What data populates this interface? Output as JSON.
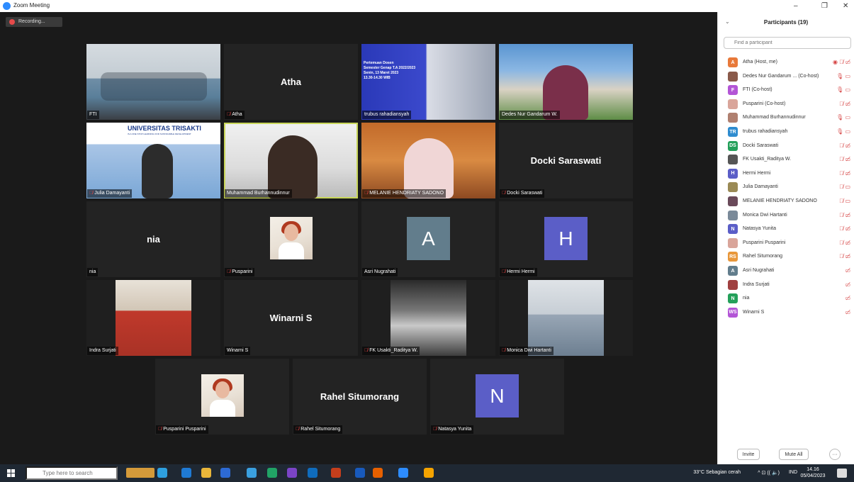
{
  "window": {
    "title": "Zoom Meeting",
    "minimize": "–",
    "restore": "❐",
    "close": "✕"
  },
  "recording": {
    "label": "Recording..."
  },
  "tiles": [
    {
      "label": "FTI",
      "muted": false
    },
    {
      "label": "Atha",
      "muted": true,
      "display_name": "Atha"
    },
    {
      "label": "trubus rahadiansyah",
      "muted": false,
      "slide_lines": [
        "Pertemuan Dosen",
        "Semester Genap T.A 2022/2023",
        "",
        "Senin, 13 Maret 2023",
        "13.30-14.30 WIB"
      ]
    },
    {
      "label": "Dedes Nur Gandarum W.",
      "muted": false
    },
    {
      "label": "Julia Damayanti",
      "muted": true,
      "banner": "UNIVERSITAS TRISAKTI",
      "banner_sub": "IS A ONE STOP LEARNING FOR SUSTAINABLE DEVELOPMENT"
    },
    {
      "label": "Muhammad Burhannudinnur",
      "muted": false
    },
    {
      "label": "MELANIE HENDRIATY SADONO",
      "muted": true
    },
    {
      "label": "Docki Saraswati",
      "muted": true,
      "display_name": "Docki Saraswati"
    },
    {
      "label": "nia",
      "muted": false,
      "display_name": "nia"
    },
    {
      "label": "Pusparini",
      "muted": true
    },
    {
      "label": "Asri Nugrahati",
      "muted": false,
      "initial": "A",
      "color": "#627d8c"
    },
    {
      "label": "Hermi Hermi",
      "muted": true,
      "initial": "H",
      "color": "#5b5ec7"
    },
    {
      "label": "Indra Surjati",
      "muted": false
    },
    {
      "label": "Winarni S",
      "muted": false,
      "display_name": "Winarni S"
    },
    {
      "label": "FK Usakti_Raditya W.",
      "muted": true
    },
    {
      "label": "Monica Dwi Hartanti",
      "muted": true
    },
    {
      "label": "Pusparini Pusparini",
      "muted": true
    },
    {
      "label": "Rahel Situmorang",
      "muted": true,
      "display_name": "Rahel Situmorang"
    },
    {
      "label": "Natasya Yunita",
      "muted": true,
      "initial": "N",
      "color": "#5b5ec7"
    }
  ],
  "sidebar": {
    "title": "Participants (19)",
    "search_placeholder": "Find a participant",
    "participants": [
      {
        "name": "Atha (Host, me)",
        "initial": "A",
        "color": "#e8793a",
        "icons": "◉ 🎙̸ ▭̸"
      },
      {
        "name": "Dedes Nur Gandarum ... (Co-host)",
        "initial": "",
        "color": "#8a5a4a",
        "icons": "🎙 ▭"
      },
      {
        "name": "FTI (Co-host)",
        "initial": "F",
        "color": "#b355d6",
        "icons": "🎙 ▭"
      },
      {
        "name": "Pusparini (Co-host)",
        "initial": "",
        "color": "#d9a59a",
        "icons": "🎙̸ ▭̸"
      },
      {
        "name": "Muhammad Burhannudinnur",
        "initial": "",
        "color": "#b08070",
        "icons": "🎙 ▭"
      },
      {
        "name": "trubus rahadiansyah",
        "initial": "TR",
        "color": "#2f8ccf",
        "icons": "🎙 ▭"
      },
      {
        "name": "Docki Saraswati",
        "initial": "DS",
        "color": "#24a05a",
        "icons": "🎙̸ ▭̸"
      },
      {
        "name": "FK Usakti_Raditya W.",
        "initial": "",
        "color": "#555555",
        "icons": "🎙̸ ▭̸"
      },
      {
        "name": "Hermi Hermi",
        "initial": "H",
        "color": "#5b5ec7",
        "icons": "🎙̸ ▭̸"
      },
      {
        "name": "Julia Damayanti",
        "initial": "",
        "color": "#9a8a55",
        "icons": "🎙̸ ▭"
      },
      {
        "name": "MELANIE HENDRIATY SADONO",
        "initial": "",
        "color": "#6a4a5a",
        "icons": "🎙̸ ▭"
      },
      {
        "name": "Monica Dwi Hartanti",
        "initial": "",
        "color": "#7a8a99",
        "icons": "🎙̸ ▭̸"
      },
      {
        "name": "Natasya Yunita",
        "initial": "N",
        "color": "#5b5ec7",
        "icons": "🎙̸ ▭̸"
      },
      {
        "name": "Pusparini Pusparini",
        "initial": "",
        "color": "#d9a59a",
        "icons": "🎙̸ ▭̸"
      },
      {
        "name": "Rahel Situmorang",
        "initial": "RS",
        "color": "#e8973a",
        "icons": "🎙̸ ▭̸"
      },
      {
        "name": "Asri Nugrahati",
        "initial": "A",
        "color": "#627d8c",
        "icons": "▭̸"
      },
      {
        "name": "Indra Surjati",
        "initial": "",
        "color": "#a04040",
        "icons": "▭̸"
      },
      {
        "name": "nia",
        "initial": "N",
        "color": "#24a05a",
        "icons": "▭̸"
      },
      {
        "name": "Winarni S",
        "initial": "WS",
        "color": "#b355d6",
        "icons": "▭̸"
      }
    ],
    "invite_label": "Invite",
    "mute_all_label": "Mute All",
    "more_label": "···"
  },
  "taskbar": {
    "search_placeholder": "Type here to search",
    "weather": "33°C  Sebagian cerah",
    "tray_icons": "^  ⊡  ((  🔈)",
    "language": "IND",
    "time": "14.16",
    "date": "05/04/2023"
  }
}
